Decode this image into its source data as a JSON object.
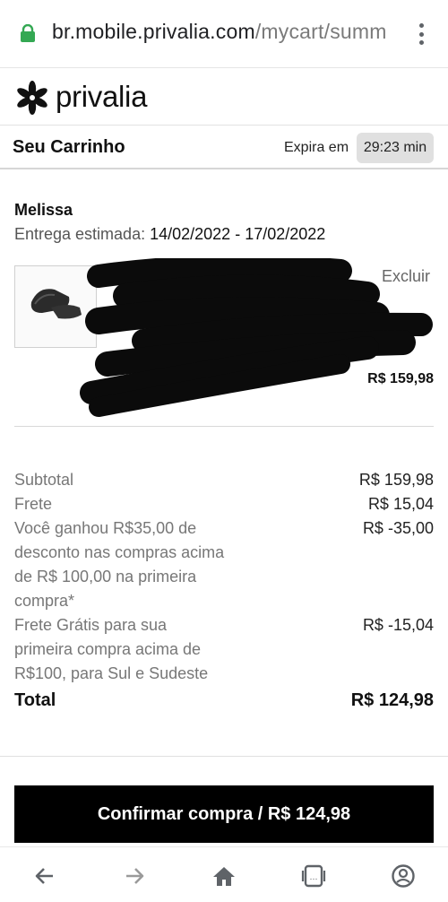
{
  "browser": {
    "url_host": "br.mobile.privalia.com",
    "url_path": "/mycart/summ"
  },
  "brand": {
    "name": "privalia"
  },
  "cart": {
    "title": "Seu Carrinho",
    "expires_label": "Expira em",
    "timer": "29:23 min"
  },
  "seller": {
    "name": "Melissa",
    "delivery_label": "Entrega estimada:",
    "delivery_dates": "14/02/2022 - 17/02/2022"
  },
  "item": {
    "remove_label": "Excluir",
    "price": "R$ 159,98"
  },
  "summary": {
    "rows": [
      {
        "label": "Subtotal",
        "value": "R$ 159,98"
      },
      {
        "label": "Frete",
        "value": "R$ 15,04"
      },
      {
        "label": "Você ganhou R$35,00 de desconto nas compras acima de R$ 100,00 na primeira compra*",
        "value": "R$ -35,00"
      },
      {
        "label": "Frete Grátis para sua primeira compra acima de R$100, para Sul e Sudeste",
        "value": "R$ -15,04"
      }
    ],
    "total_label": "Total",
    "total_value": "R$ 124,98"
  },
  "confirm_button": {
    "label": "Confirmar compra / R$ 124,98"
  },
  "colors": {
    "lock_green": "#34a853",
    "button_bg": "#000000",
    "timer_bg": "#e0e0e0"
  },
  "icons": {
    "lock": "lock-icon",
    "menu": "more-vert-icon",
    "back": "arrow-left-icon",
    "forward": "arrow-right-icon",
    "home": "home-icon",
    "tabs": "tabs-icon",
    "account": "account-icon"
  }
}
